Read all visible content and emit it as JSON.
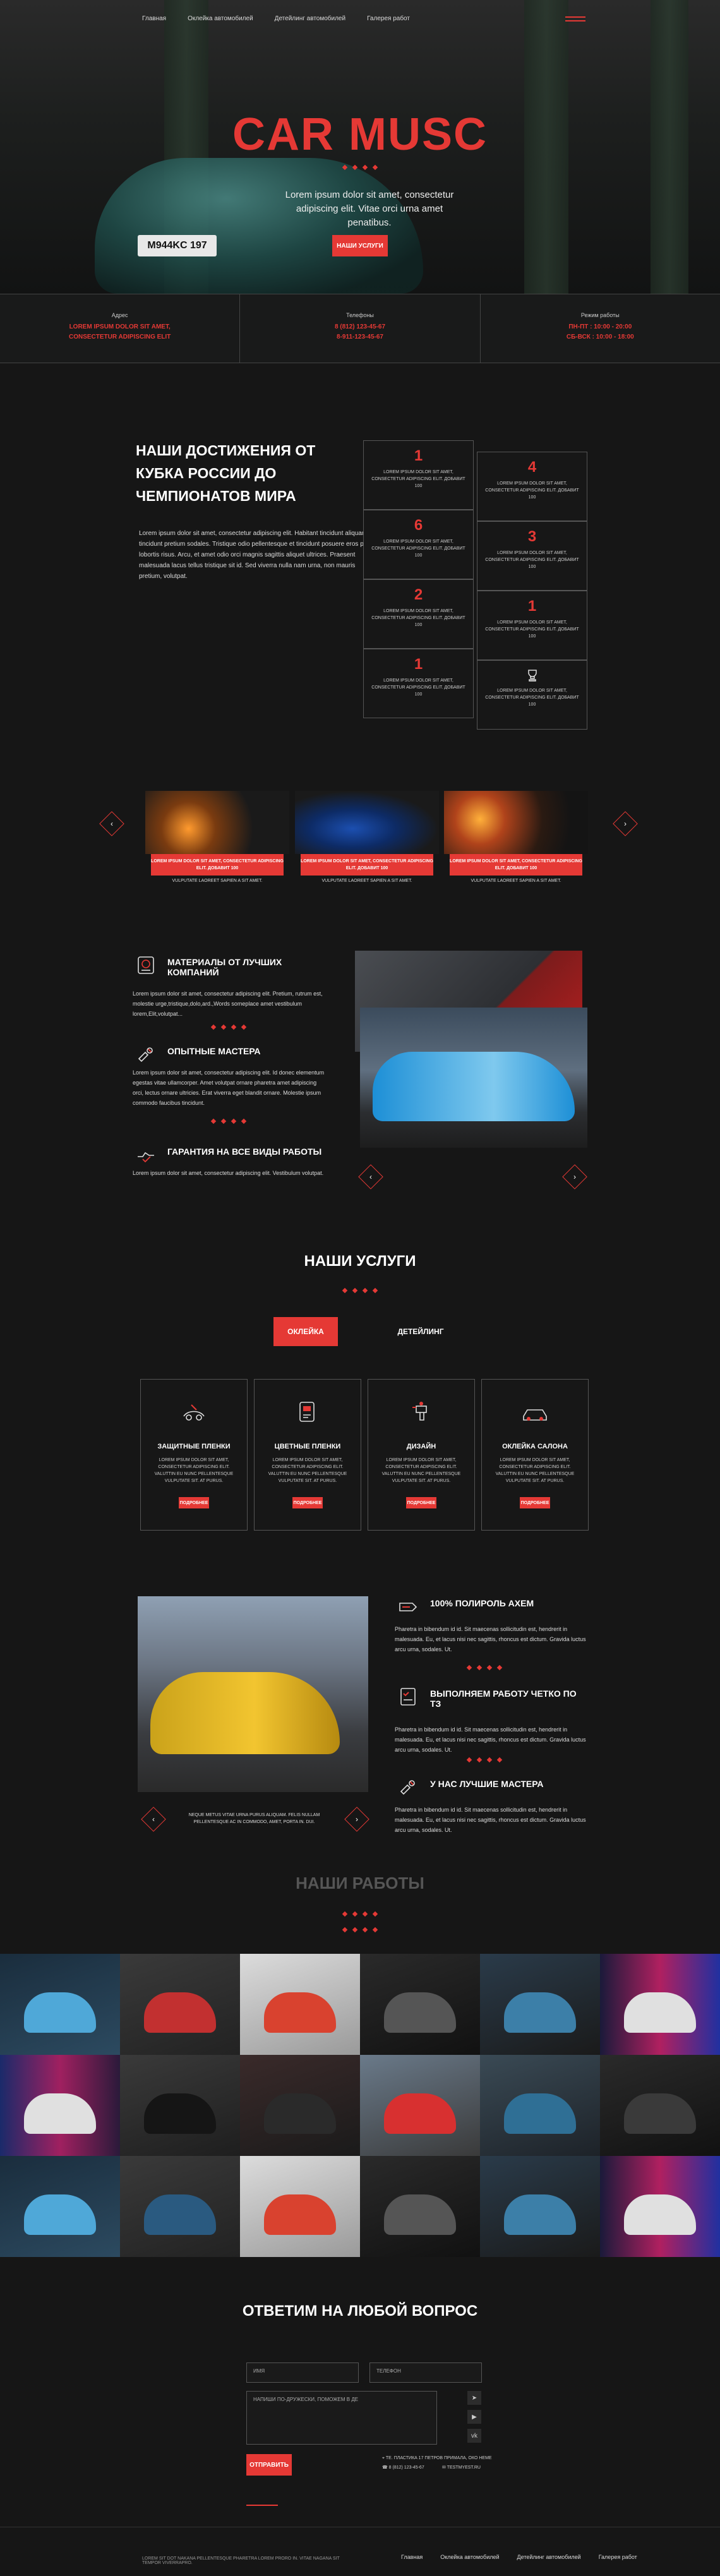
{
  "nav": [
    "Главная",
    "Оклейка автомобилей",
    "Детейлинг автомобилей",
    "Галерея работ"
  ],
  "hero": {
    "title": "CAR MUSC",
    "subtitle": "Lorem ipsum dolor sit amet, consectetur adipiscing elit. Vitae orci urna amet penatibus.",
    "button": "НАШИ УСЛУГИ",
    "plate": "M944KC 197"
  },
  "info": {
    "address_label": "Адрес",
    "address_value": "LOREM IPSUM DOLOR SIT AMET, CONSECTETUR ADIPISCING ELIT",
    "phones_label": "Телефоны",
    "phone1": "8 (812) 123-45-67",
    "phone2": "8-911-123-45-67",
    "hours_label": "Режим работы",
    "hours1": "ПН-ПТ : 10:00 - 20:00",
    "hours2": "СБ-ВСК : 10:00 - 18:00"
  },
  "achievements": {
    "title": "НАШИ ДОСТИЖЕНИЯ ОТ КУБКА РОССИИ ДО ЧЕМПИОНАТОВ МИРА",
    "text": "Lorem ipsum dolor sit amet, consectetur adipiscing elit. Habitant tincidunt aliquam tincidunt pretium sodales. Tristique odio pellentesque et tincidunt posuere eros proin lobortis risus. Arcu, et amet odio orci magnis sagittis aliquet ultrices. Praesent malesuada lacus tellus tristique sit id. Sed viverra nulla nam urna, non mauris pretium, volutpat.",
    "cards": [
      {
        "num": "1",
        "text": "LOREM IPSUM DOLOR SIT AMET, CONSECTETUR ADIPISCING ELIT. ДОБАВИТ 100"
      },
      {
        "num": "4",
        "text": "LOREM IPSUM DOLOR SIT AMET, CONSECTETUR ADIPISCING ELIT. ДОБАВИТ 100"
      },
      {
        "num": "6",
        "text": "LOREM IPSUM DOLOR SIT AMET, CONSECTETUR ADIPISCING ELIT. ДОБАВИТ 100"
      },
      {
        "num": "3",
        "text": "LOREM IPSUM DOLOR SIT AMET, CONSECTETUR ADIPISCING ELIT. ДОБАВИТ 100"
      },
      {
        "num": "2",
        "text": "LOREM IPSUM DOLOR SIT AMET, CONSECTETUR ADIPISCING ELIT. ДОБАВИТ 100"
      },
      {
        "num": "1",
        "text": "LOREM IPSUM DOLOR SIT AMET, CONSECTETUR ADIPISCING ELIT. ДОБАВИТ 100"
      },
      {
        "num": "1",
        "text": "LOREM IPSUM DOLOR SIT AMET, CONSECTETUR ADIPISCING ELIT. ДОБАВИТ 100"
      },
      {
        "num": "",
        "text": "LOREM IPSUM DOLOR SIT AMET, CONSECTETUR ADIPISCING ELIT. ДОБАВИТ 100"
      }
    ]
  },
  "slider1": [
    {
      "caption": "LOREM IPSUM DOLOR SIT AMET, CONSECTETUR ADIPISCING ELIT. ДОБАВИТ 100",
      "sub": "VULPUTATE LAOREET SAPIEN A SIT AMET."
    },
    {
      "caption": "LOREM IPSUM DOLOR SIT AMET, CONSECTETUR ADIPISCING ELIT. ДОБАВИТ 100",
      "sub": "VULPUTATE LAOREET SAPIEN A SIT AMET."
    },
    {
      "caption": "LOREM IPSUM DOLOR SIT AMET, CONSECTETUR ADIPISCING ELIT. ДОБАВИТ 100",
      "sub": "VULPUTATE LAOREET SAPIEN A SIT AMET."
    }
  ],
  "features1": [
    {
      "title": "МАТЕРИАЛЫ ОТ ЛУЧШИХ КОМПАНИЙ",
      "text": "Lorem ipsum dolor sit amet, consectetur adipiscing elit. Pretium, rutrum est, molestie urge,tristique,dolo,ard.,Words someplace amet vestibulum lorem,Elit,volutpat..."
    },
    {
      "title": "ОПЫТНЫЕ МАСТЕРА",
      "text": "Lorem ipsum dolor sit amet, consectetur adipiscing elit. Id donec elementum egestas vitae ullamcorper. Amet volutpat ornare pharetra amet adipiscing orci, lectus ornare ultricies. Erat viverra eget blandit ornare. Molestie ipsum commodo faucibus tincidunt."
    },
    {
      "title": "ГАРАНТИЯ НА ВСЕ ВИДЫ РАБОТЫ",
      "text": "Lorem ipsum dolor sit amet, consectetur adipiscing elit. Vestibulum volutpat."
    }
  ],
  "services": {
    "title": "НАШИ УСЛУГИ",
    "tab_active": "ОКЛЕЙКА",
    "tab_inactive": "ДЕТЕЙЛИНГ",
    "cards": [
      {
        "title": "ЗАЩИТНЫЕ ПЛЕНКИ",
        "text": "LOREM IPSUM DOLOR SIT AMET, CONSECTETUR ADIPISCING ELIT. VALUTTIN EU NUNC PELLENTESQUE VULPUTATE SIT. AT PURUS.",
        "button": "ПОДРОБНЕЕ"
      },
      {
        "title": "ЦВЕТНЫЕ ПЛЕНКИ",
        "text": "LOREM IPSUM DOLOR SIT AMET, CONSECTETUR ADIPISCING ELIT. VALUTTIN EU NUNC PELLENTESQUE VULPUTATE SIT. AT PURUS.",
        "button": "ПОДРОБНЕЕ"
      },
      {
        "title": "ДИЗАЙН",
        "text": "LOREM IPSUM DOLOR SIT AMET, CONSECTETUR ADIPISCING ELIT. VALUTTIN EU NUNC PELLENTESQUE VULPUTATE SIT. AT PURUS.",
        "button": "ПОДРОБНЕЕ"
      },
      {
        "title": "ОКЛЕЙКА САЛОНА",
        "text": "LOREM IPSUM DOLOR SIT AMET, CONSECTETUR ADIPISCING ELIT. VALUTTIN EU NUNC PELLENTESQUE VULPUTATE SIT. AT PURUS.",
        "button": "ПОДРОБНЕЕ"
      }
    ]
  },
  "features2": [
    {
      "title": "100% ПОЛИРОЛЬ AXEM",
      "text": "Pharetra in bibendum id id. Sit maecenas sollicitudin est, hendrerit in malesuada. Eu, et lacus nisi nec sagittis, rhoncus est dictum. Gravida luctus arcu urna, sodales. Ut."
    },
    {
      "title": "ВЫПОЛНЯЕМ РАБОТУ ЧЕТКО ПО ТЗ",
      "text": "Pharetra in bibendum id id. Sit maecenas sollicitudin est, hendrerit in malesuada. Eu, et lacus nisi nec sagittis, rhoncus est dictum. Gravida luctus arcu urna, sodales. Ut."
    },
    {
      "title": "У НАС ЛУЧШИЕ МАСТЕРА",
      "text": "Pharetra in bibendum id id. Sit maecenas sollicitudin est, hendrerit in malesuada. Eu, et lacus nisi nec sagittis, rhoncus est dictum. Gravida luctus arcu urna, sodales. Ut."
    }
  ],
  "slider2_caption": "NEQUE METUS VITAE URNA PURUS ALIQUAM. FELIS NULLAM PELLENTESQUE AC IN COMMODO, AMET, PORTA IN. DUI.",
  "works": {
    "title": "НАШИ РАБОТЫ"
  },
  "contact": {
    "title": "ОТВЕТИМ НА ЛЮБОЙ ВОПРОС",
    "name_placeholder": "ИМЯ",
    "phone_placeholder": "ТЕЛЕФОН",
    "message_placeholder": "НАПИШИ ПО-ДРУЖЕСКИ, ПОМОЖЕМ В ДЕ",
    "button": "ОТПРАВИТЬ",
    "address": "ТЕ. ПЛАСТИКА 17 ПЕТРОВ ПРИМАЛА, ОКО НЕМЕ",
    "phone": "8 (812) 123-45-67",
    "email": "TESTMYEST.RU"
  },
  "footer": {
    "copyright": "LOREM SIT DOT NAKANA PELLENTESQUE PHARETRA LOREM PRORO IN. VITAE NAGANA SIT TEMPOR VIVERRAPRO.",
    "links": [
      "Главная",
      "Оклейка автомобилей",
      "Детейлинг автомобилей",
      "Галерея работ"
    ]
  },
  "colors": {
    "accent": "#e53935",
    "background": "#161616",
    "border": "#555555"
  }
}
